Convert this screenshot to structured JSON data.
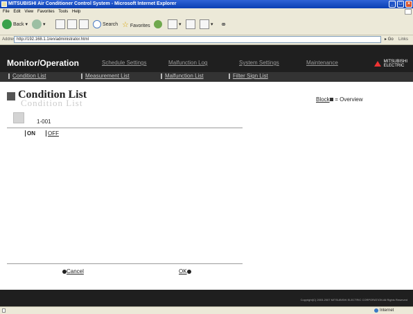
{
  "window": {
    "title": "MITSUBISHI Air Conditioner Control System - Microsoft Internet Explorer"
  },
  "menu": [
    "File",
    "Edit",
    "View",
    "Favorites",
    "Tools",
    "Help"
  ],
  "toolbar": {
    "back_label": "Back",
    "search_label": "Search",
    "favorites_label": "Favorites"
  },
  "address": {
    "label": "Address",
    "url": "http://192.168.1.1/en/administrator.html",
    "go_label": "Go",
    "links_label": "Links"
  },
  "header": {
    "app_title": "Monitor/Operation",
    "nav": [
      "Schedule Settings",
      "Malfunction Log",
      "System Settings",
      "Maintenance"
    ],
    "logo_text": [
      "MITSUBISHI",
      "ELECTRIC"
    ]
  },
  "subnav": [
    "Condition List",
    "Measurement List",
    "Malfunction List",
    "Filter Sign List"
  ],
  "page": {
    "title": "Condition List",
    "block_label": "Block",
    "overview_label": "Overview",
    "unit_label": "1-001",
    "on_label": "ON",
    "off_label": "OFF",
    "cancel_label": "Cancel",
    "ok_label": "OK"
  },
  "footer": {
    "copyright": "Copyright(C) 2003-2007 MITSUBISHI ELECTRIC CORPORATION All Rights Reserved"
  },
  "status": {
    "zone": "Internet"
  },
  "colors": {
    "title_bar": "#0a3fb3",
    "header_bg": "#1f1f1f",
    "subnav_bg": "#333333",
    "logo_red": "#e33333"
  }
}
